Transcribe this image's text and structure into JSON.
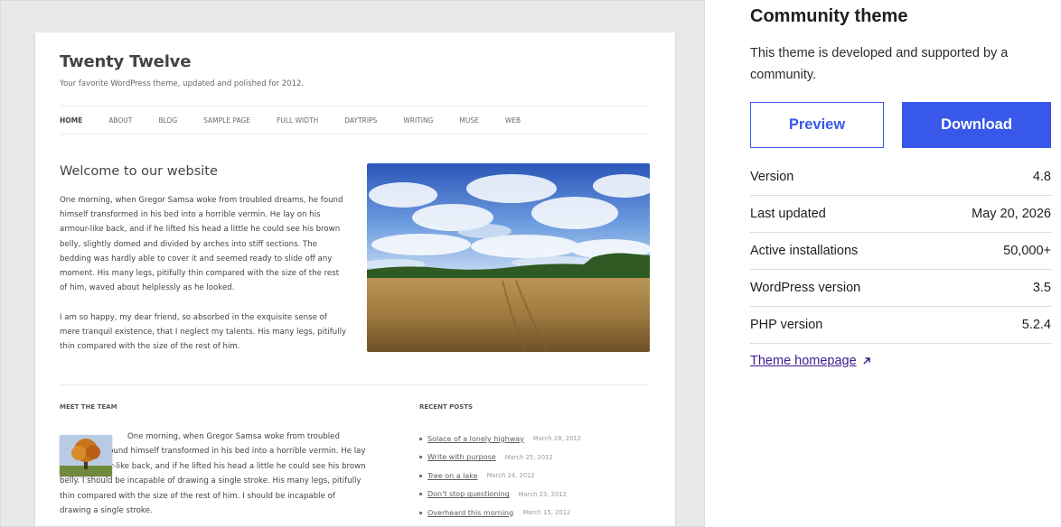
{
  "theme_preview": {
    "site_title": "Twenty Twelve",
    "site_description": "Your favorite WordPress theme, updated and polished for 2012.",
    "nav": [
      {
        "label": "HOME",
        "current": true
      },
      {
        "label": "ABOUT",
        "current": false
      },
      {
        "label": "BLOG",
        "current": false
      },
      {
        "label": "SAMPLE PAGE",
        "current": false
      },
      {
        "label": "FULL WIDTH",
        "current": false
      },
      {
        "label": "DAYTRIPS",
        "current": false
      },
      {
        "label": "WRITING",
        "current": false
      },
      {
        "label": "MUSE",
        "current": false
      },
      {
        "label": "WEB",
        "current": false
      }
    ],
    "welcome_heading": "Welcome to our website",
    "paragraph1": "One morning, when Gregor Samsa woke from troubled dreams, he found himself transformed in his bed into a horrible vermin. He lay on his armour-like back, and if he lifted his head a little he could see his brown belly, slightly domed and divided by arches into stiff sections. The bedding was hardly able to cover it and seemed ready to slide off any moment. His many legs, pitifully thin compared with the size of the rest of him, waved about helplessly as he looked.",
    "paragraph2": "I am so happy, my dear friend, so absorbed in the exquisite sense of mere tranquil existence, that I neglect my talents. His many legs, pitifully thin compared with the size of the rest of him.",
    "meet_team": {
      "title": "MEET THE TEAM",
      "text": "One morning, when Gregor Samsa woke from troubled dreams, he found himself transformed in his bed into a horrible vermin. He lay on his armour-like back, and if he lifted his head a little he could see his brown belly. I should be incapable of drawing a single stroke. His many legs, pitifully thin compared with the size of the rest of him. I should be incapable of drawing a single stroke."
    },
    "recent_posts": {
      "title": "RECENT POSTS",
      "items": [
        {
          "title": "Solace of a lonely highway",
          "date": "March 28, 2012"
        },
        {
          "title": "Write with purpose",
          "date": "March 25, 2012"
        },
        {
          "title": "Tree on a lake",
          "date": "March 24, 2012"
        },
        {
          "title": "Don't stop questioning",
          "date": "March 23, 2012"
        },
        {
          "title": "Overheard this morning",
          "date": "March 15, 2012"
        }
      ]
    }
  },
  "panel": {
    "title": "Community theme",
    "description": "This theme is developed and supported by a community.",
    "preview_label": "Preview",
    "download_label": "Download",
    "meta": [
      {
        "label": "Version",
        "value": "4.8"
      },
      {
        "label": "Last updated",
        "value": "May 20, 2026"
      },
      {
        "label": "Active installations",
        "value": "50,000+"
      },
      {
        "label": "WordPress version",
        "value": "3.5"
      },
      {
        "label": "PHP version",
        "value": "5.2.4"
      }
    ],
    "homepage_label": "Theme homepage",
    "homepage_icon": "external-link-icon"
  },
  "colors": {
    "accent": "#3858e9",
    "link_visited": "#3f1d8f"
  }
}
